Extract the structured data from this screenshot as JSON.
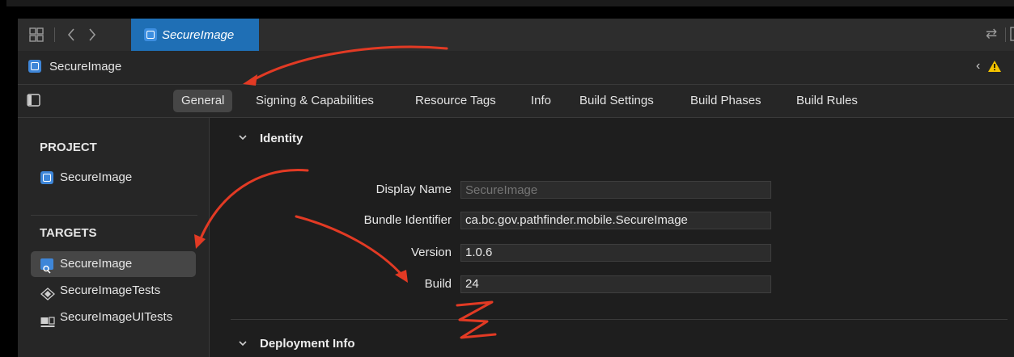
{
  "tabbar": {
    "active_tab": "SecureImage"
  },
  "breadcrumb": {
    "project": "SecureImage"
  },
  "editor_tabs": [
    {
      "label": "General",
      "active": true
    },
    {
      "label": "Signing & Capabilities"
    },
    {
      "label": "Resource Tags"
    },
    {
      "label": "Info"
    },
    {
      "label": "Build Settings"
    },
    {
      "label": "Build Phases"
    },
    {
      "label": "Build Rules"
    }
  ],
  "sidebar": {
    "project_header": "PROJECT",
    "project_item": "SecureImage",
    "targets_header": "TARGETS",
    "targets": [
      "SecureImage",
      "SecureImageTests",
      "SecureImageUITests"
    ]
  },
  "identity": {
    "title": "Identity",
    "display_name_label": "Display Name",
    "display_name_placeholder": "SecureImage",
    "bundle_id_label": "Bundle Identifier",
    "bundle_id": "ca.bc.gov.pathfinder.mobile.SecureImage",
    "version_label": "Version",
    "version": "1.0.6",
    "build_label": "Build",
    "build": "24"
  },
  "deployment": {
    "title": "Deployment Info"
  },
  "colors": {
    "accent": "#1f6fb5",
    "annotation": "#e23a24",
    "warning": "#f5c400"
  },
  "icons": [
    "grid-icon",
    "back-chevron-icon",
    "forward-chevron-icon",
    "app-icon",
    "swap-arrows-icon",
    "add-editor-icon",
    "sidebar-toggle-icon",
    "warning-icon",
    "test-target-icon",
    "ui-test-target-icon",
    "app-target-icon"
  ]
}
